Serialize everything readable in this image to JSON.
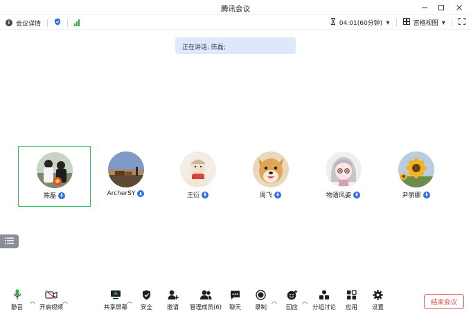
{
  "window": {
    "title": "腾讯会议"
  },
  "infobar": {
    "meeting_details": "会议详情",
    "timer": "04:01(60分钟)",
    "view_mode": "宫格视图"
  },
  "speaking": {
    "text": "正在讲话: 陈磊;"
  },
  "participants": [
    {
      "name": "陈磊",
      "active": true
    },
    {
      "name": "ArcherSY",
      "active": false
    },
    {
      "name": "王衍",
      "active": false
    },
    {
      "name": "周飞",
      "active": false
    },
    {
      "name": "物语风姿",
      "active": false
    },
    {
      "name": "尹丽娜",
      "active": false
    }
  ],
  "toolbar": {
    "mute": "静音",
    "video": "开启视频",
    "share": "共享屏幕",
    "security": "安全",
    "invite": "邀请",
    "members": "管理成员(6)",
    "chat": "聊天",
    "record": "录制",
    "react": "回应",
    "breakout": "分组讨论",
    "apps": "应用",
    "settings": "设置",
    "end": "结束会议"
  },
  "colors": {
    "accent_green": "#2ac35b",
    "mic_blue": "#2d6fe2",
    "banner_bg": "#dde9f8",
    "end_red": "#e14545"
  }
}
